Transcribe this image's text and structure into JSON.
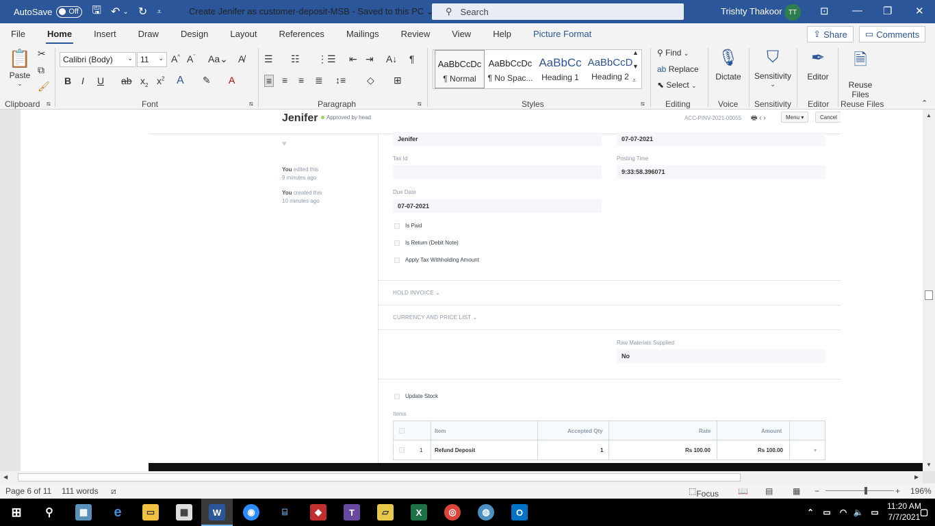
{
  "titlebar": {
    "autosave_label": "AutoSave",
    "autosave_state": "Off",
    "document_title": "Create Jenifer as customer-deposit-MSB  -  Saved to this PC",
    "search_placeholder": "Search",
    "user_name": "Trishty Thakoor",
    "user_initials": "TT"
  },
  "menu": {
    "tabs": [
      "File",
      "Home",
      "Insert",
      "Draw",
      "Design",
      "Layout",
      "References",
      "Mailings",
      "Review",
      "View",
      "Help",
      "Picture Format"
    ],
    "active_tab": "Home",
    "share_label": "Share",
    "comments_label": "Comments"
  },
  "ribbon": {
    "clipboard": {
      "paste": "Paste",
      "label": "Clipboard"
    },
    "font": {
      "name": "Calibri (Body)",
      "size": "11",
      "label": "Font"
    },
    "paragraph": {
      "label": "Paragraph"
    },
    "styles": {
      "label": "Styles",
      "items": [
        {
          "preview": "AaBbCcDc",
          "name": "¶ Normal"
        },
        {
          "preview": "AaBbCcDc",
          "name": "¶ No Spac..."
        },
        {
          "preview": "AaBbCc",
          "name": "Heading 1"
        },
        {
          "preview": "AaBbCcD",
          "name": "Heading 2"
        }
      ]
    },
    "editing": {
      "find": "Find",
      "replace": "Replace",
      "select": "Select",
      "label": "Editing"
    },
    "voice": {
      "dictate": "Dictate",
      "label": "Voice"
    },
    "sensitivity": {
      "button": "Sensitivity",
      "label": "Sensitivity"
    },
    "editor": {
      "button": "Editor",
      "label": "Editor"
    },
    "reuse": {
      "button1": "Reuse",
      "button2": "Files",
      "label": "Reuse Files"
    }
  },
  "erp": {
    "title": "Jenifer",
    "status": "Approved by head",
    "doc_id": "ACC-PINV-2021-00055",
    "menu_btn": "Menu",
    "cancel_btn": "Cancel",
    "activity": [
      {
        "who": "You",
        "what": "edited this",
        "when": "9 minutes ago"
      },
      {
        "who": "You",
        "what": "created this",
        "when": "10 minutes ago"
      }
    ],
    "fields": {
      "supplier_value": "Jenifer",
      "date_value": "07-07-2021",
      "tax_id_label": "Tax Id",
      "tax_id_value": "",
      "posting_time_label": "Posting Time",
      "posting_time_value": "9:33:58.396071",
      "due_date_label": "Due Date",
      "due_date_value": "07-07-2021",
      "is_paid": "Is Paid",
      "is_return": "Is Return (Debit Note)",
      "apply_tax": "Apply Tax Withholding Amount",
      "hold_invoice": "HOLD INVOICE",
      "currency_price": "CURRENCY AND PRICE LIST",
      "raw_materials_label": "Raw Materials Supplied",
      "raw_materials_value": "No",
      "update_stock": "Update Stock",
      "items_label": "Items"
    },
    "table": {
      "headers": [
        "Item",
        "Accepted Qty",
        "Rate",
        "Amount"
      ],
      "rows": [
        {
          "idx": "1",
          "item": "Refund Deposit",
          "qty": "1",
          "rate": "Rs 100.00",
          "amount": "Rs 100.00"
        }
      ]
    }
  },
  "statusbar": {
    "page": "Page 6 of 11",
    "words": "111 words",
    "focus": "Focus",
    "zoom": "196%"
  },
  "taskbar": {
    "time": "11:20 AM",
    "date": "7/7/2021"
  },
  "colors": {
    "word_blue": "#2b579a",
    "status_green": "#98d85b"
  }
}
